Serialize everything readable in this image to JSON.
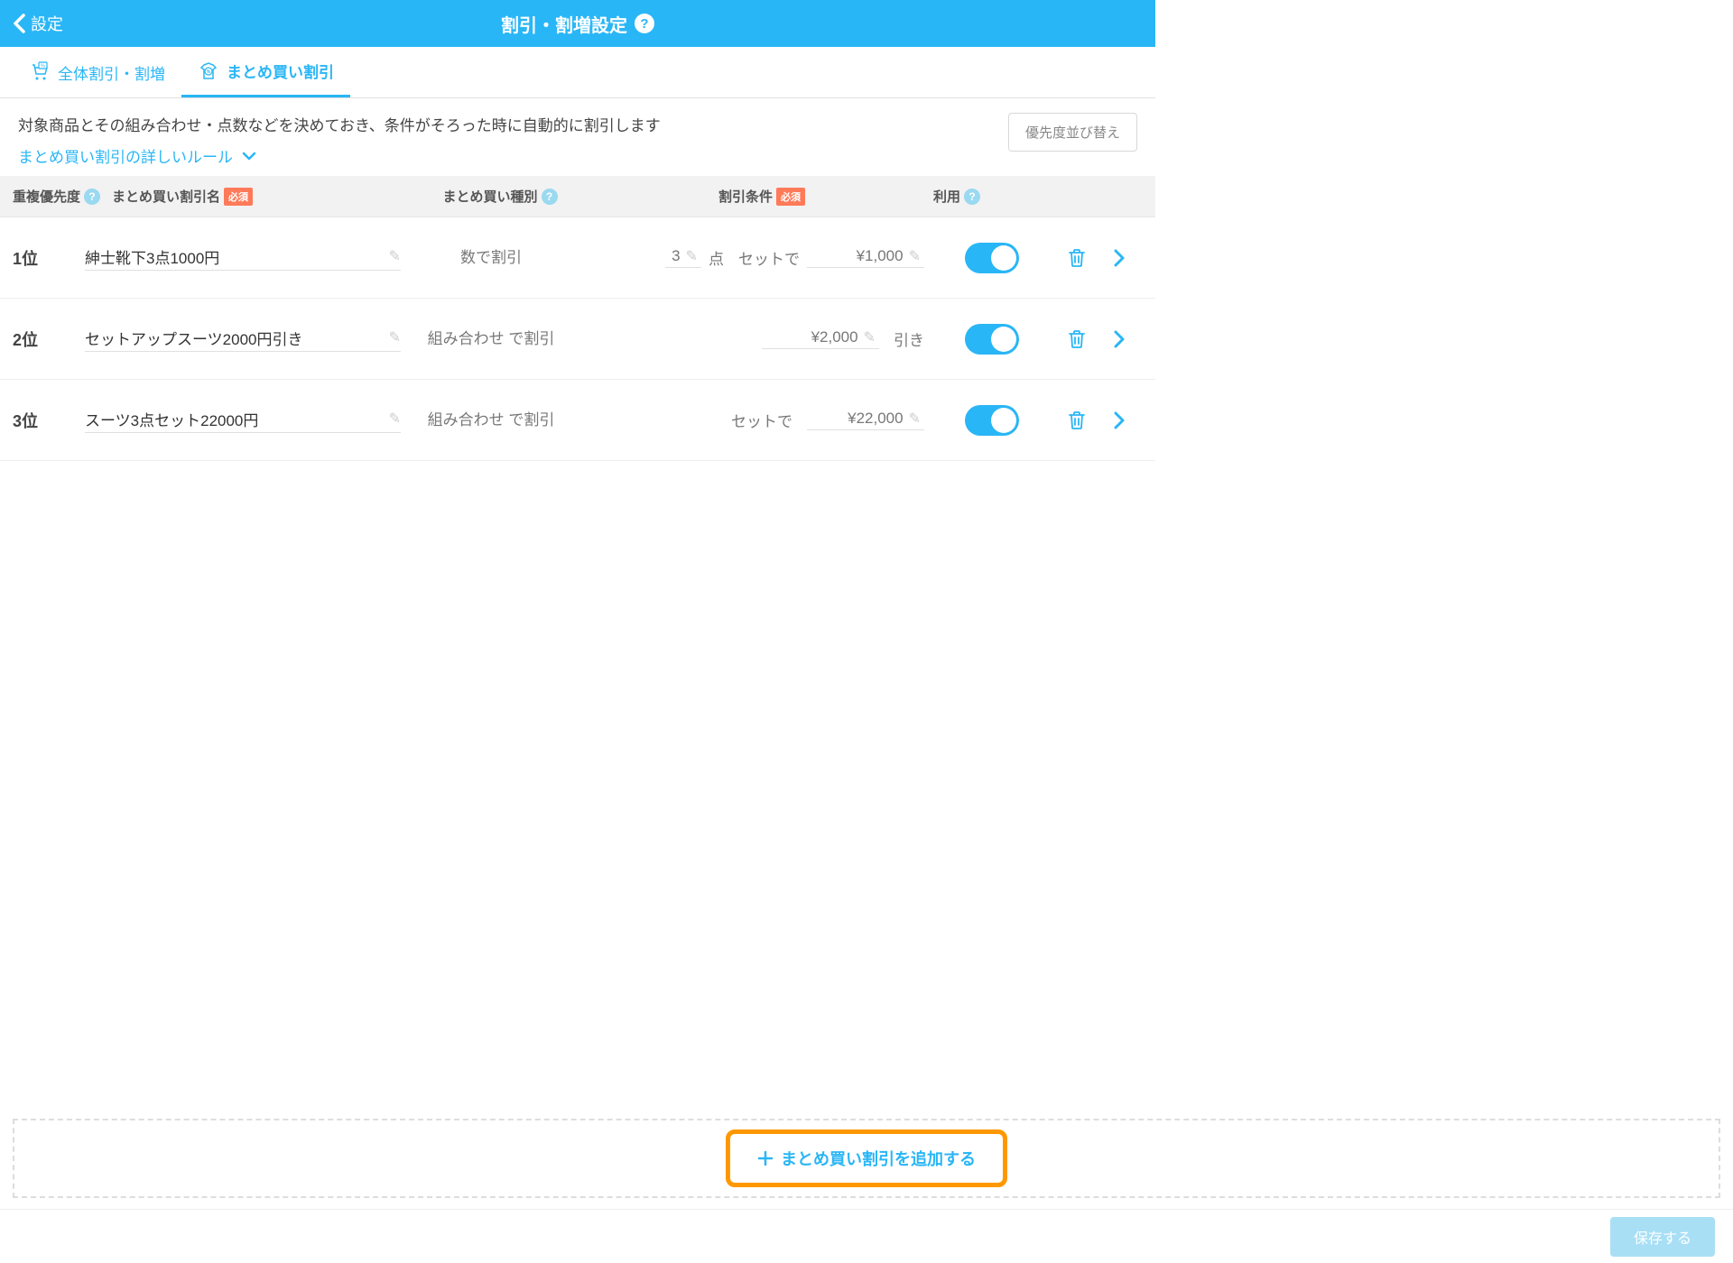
{
  "header": {
    "back_label": "設定",
    "title": "割引・割増設定"
  },
  "tabs": [
    {
      "label": "全体割引・割増"
    },
    {
      "label": "まとめ買い割引"
    }
  ],
  "desc": {
    "text": "対象商品とその組み合わせ・点数などを決めておき、条件がそろった時に自動的に割引します",
    "rules_link": "まとめ買い割引の詳しいルール",
    "reorder_btn": "優先度並び替え"
  },
  "columns": {
    "priority": "重複優先度",
    "name": "まとめ買い割引名",
    "type": "まとめ買い種別",
    "cond": "割引条件",
    "use": "利用",
    "required": "必須"
  },
  "rows": [
    {
      "priority": "1位",
      "name": "紳士靴下3点1000円",
      "type": "数で割引",
      "qty": "3",
      "qty_unit": "点",
      "cond_text": "セットで",
      "price": "¥1,000"
    },
    {
      "priority": "2位",
      "name": "セットアップスーツ2000円引き",
      "type": "組み合わせ\nで割引",
      "qty": "",
      "qty_unit": "",
      "cond_text": "引き",
      "price": "¥2,000",
      "price_first": true
    },
    {
      "priority": "3位",
      "name": "スーツ3点セット22000円",
      "type": "組み合わせ\nで割引",
      "qty": "",
      "qty_unit": "",
      "cond_text": "セットで",
      "price": "¥22,000"
    }
  ],
  "add_btn": "まとめ買い割引を追加する",
  "save_btn": "保存する"
}
